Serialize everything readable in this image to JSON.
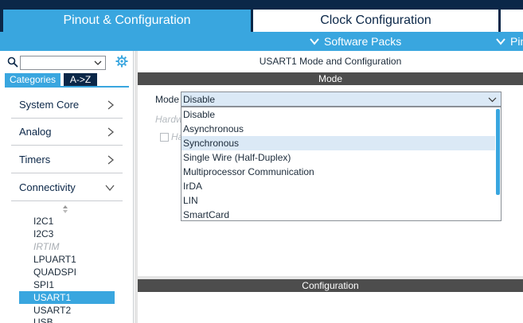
{
  "tabs": {
    "pinout": "Pinout & Configuration",
    "clock": "Clock Configuration"
  },
  "subbar": {
    "software_packs": "Software Packs",
    "pinout_partial": "Pin"
  },
  "sidebar": {
    "search_value": "",
    "category_tabs": [
      "Categories",
      "A->Z"
    ],
    "groups": [
      "System Core",
      "Analog",
      "Timers",
      "Connectivity"
    ],
    "peripherals": [
      {
        "label": "I2C1",
        "state": "normal"
      },
      {
        "label": "I2C3",
        "state": "normal"
      },
      {
        "label": "IRTIM",
        "state": "disabled"
      },
      {
        "label": "LPUART1",
        "state": "normal"
      },
      {
        "label": "QUADSPI",
        "state": "normal"
      },
      {
        "label": "SPI1",
        "state": "normal"
      },
      {
        "label": "USART1",
        "state": "selected"
      },
      {
        "label": "USART2",
        "state": "normal"
      },
      {
        "label": "USB",
        "state": "normal"
      }
    ]
  },
  "main": {
    "title": "USART1 Mode and Configuration",
    "mode_section": "Mode",
    "mode_label": "Mode",
    "mode_value": "Disable",
    "hardware_label": "Hardw",
    "hardware_check_label": "Ha",
    "mode_options": [
      "Disable",
      "Asynchronous",
      "Synchronous",
      "Single Wire (Half-Duplex)",
      "Multiprocessor Communication",
      "IrDA",
      "LIN",
      "SmartCard"
    ],
    "highlighted_option": "Synchronous",
    "config_section": "Configuration"
  },
  "colors": {
    "accent": "#39a6df",
    "navy": "#0b2748",
    "section_bar": "#4d4d4d",
    "highlight": "#dbe9f6"
  }
}
